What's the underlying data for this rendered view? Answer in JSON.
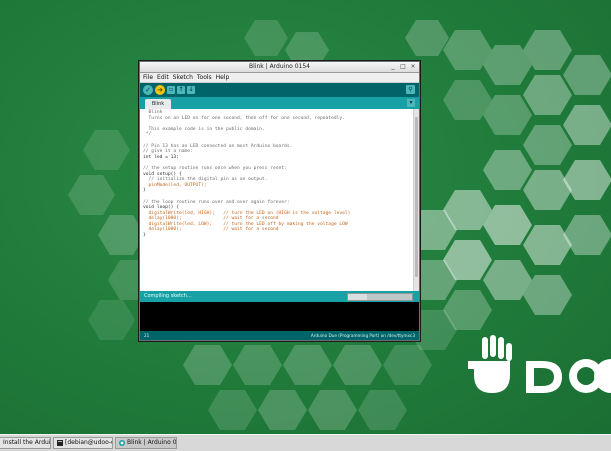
{
  "window": {
    "title": "Blink | Arduino 0154",
    "controls": [
      "_",
      "□",
      "×"
    ]
  },
  "menubar": [
    "File",
    "Edit",
    "Sketch",
    "Tools",
    "Help"
  ],
  "toolbar": {
    "verify_icon": "check-icon",
    "upload_icon": "arrow-right-icon",
    "new_icon": "new-file-icon",
    "open_icon": "open-icon",
    "save_icon": "save-icon",
    "serial_icon": "magnifier-icon"
  },
  "tab": {
    "label": "Blink"
  },
  "code_lines": [
    {
      "cls": "c",
      "text": "  Blink"
    },
    {
      "cls": "c",
      "text": "  Turns on an LED on for one second, then off for one second, repeatedly."
    },
    {
      "cls": "c",
      "text": ""
    },
    {
      "cls": "c",
      "text": "  This example code is in the public domain."
    },
    {
      "cls": "c",
      "text": " */"
    },
    {
      "cls": "c",
      "text": ""
    },
    {
      "cls": "c",
      "text": "// Pin 13 has an LED connected on most Arduino boards."
    },
    {
      "cls": "c",
      "text": "// give it a name:"
    },
    {
      "cls": "t",
      "text": "int led = 13;"
    },
    {
      "cls": "c",
      "text": ""
    },
    {
      "cls": "c",
      "text": "// the setup routine runs once when you press reset:"
    },
    {
      "cls": "t",
      "text": "void setup() {"
    },
    {
      "cls": "c",
      "text": "  // initialize the digital pin as an output."
    },
    {
      "cls": "k",
      "text": "  pinMode(led, OUTPUT);"
    },
    {
      "cls": "t",
      "text": "}"
    },
    {
      "cls": "c",
      "text": ""
    },
    {
      "cls": "c",
      "text": "// the loop routine runs over and over again forever:"
    },
    {
      "cls": "t",
      "text": "void loop() {"
    },
    {
      "cls": "k",
      "text": "  digitalWrite(led, HIGH);   // turn the LED on (HIGH is the voltage level)"
    },
    {
      "cls": "k",
      "text": "  delay(1000);               // wait for a second"
    },
    {
      "cls": "k",
      "text": "  digitalWrite(led, LOW);    // turn the LED off by making the voltage LOW"
    },
    {
      "cls": "k",
      "text": "  delay(1000);               // wait for a second"
    },
    {
      "cls": "t",
      "text": "}"
    }
  ],
  "status": {
    "text": "Compiling sketch...",
    "progress": 0.3
  },
  "footer": {
    "line": "21",
    "board": "Arduino Due (Programming Port) on /dev/ttymxc3"
  },
  "taskbar": [
    {
      "label": "Install the Arduin..."
    },
    {
      "label": "[debian@udoo-d..."
    },
    {
      "label": "Blink | Arduino 0..."
    }
  ],
  "colors": {
    "desktop": "#1f7a3a",
    "arduino_teal": "#006468",
    "arduino_light": "#17a1a5"
  }
}
